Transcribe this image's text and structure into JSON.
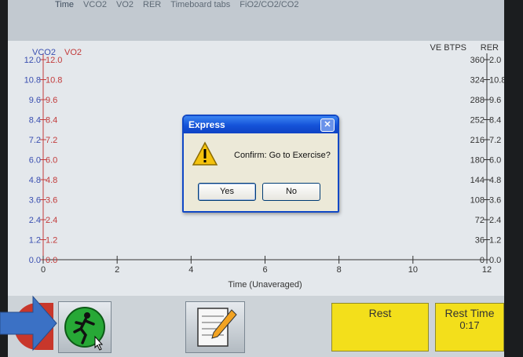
{
  "tabs": [
    "Time",
    "VCO2",
    "VO2",
    "RER",
    "Timeboard tabs",
    "FiO2/CO2/CO2"
  ],
  "chart_data": {
    "type": "line",
    "xlabel": "Time (Unaveraged)",
    "xlim": [
      0,
      12
    ],
    "x_ticks": [
      "0",
      "2",
      "4",
      "6",
      "8",
      "10",
      "12"
    ],
    "left_axis_titles": [
      "VCO2",
      "VO2"
    ],
    "left_ticks_vco2": [
      "12.0",
      "10.8",
      "9.6",
      "8.4",
      "7.2",
      "6.0",
      "4.8",
      "3.6",
      "2.4",
      "1.2",
      "0.0"
    ],
    "left_ticks_vo2": [
      "12.0",
      "10.8",
      "9.6",
      "8.4",
      "7.2",
      "6.0",
      "4.8",
      "3.6",
      "2.4",
      "1.2",
      "0.0"
    ],
    "right_axis_titles": [
      "VE BTPS",
      "RER"
    ],
    "right_ticks_ve": [
      "360",
      "324",
      "288",
      "252",
      "216",
      "180",
      "144",
      "108",
      "72",
      "36",
      "0"
    ],
    "right_ticks_rer": [
      "2.0",
      "10.8",
      "9.6",
      "8.4",
      "7.2",
      "6.0",
      "4.8",
      "3.6",
      "2.4",
      "1.2",
      "0.0"
    ],
    "series": []
  },
  "dialog": {
    "title": "Express",
    "message": "Confirm: Go to Exercise?",
    "yes_label": "Yes",
    "no_label": "No"
  },
  "status": {
    "rest_label": "Rest",
    "rest_time_label": "Rest Time",
    "rest_time_value": "0:17"
  },
  "colors": {
    "vco2": "#3a4fb0",
    "vo2": "#c23a3a",
    "yellow_panel": "#f3df1b",
    "dialog_title": "#1452d8"
  }
}
